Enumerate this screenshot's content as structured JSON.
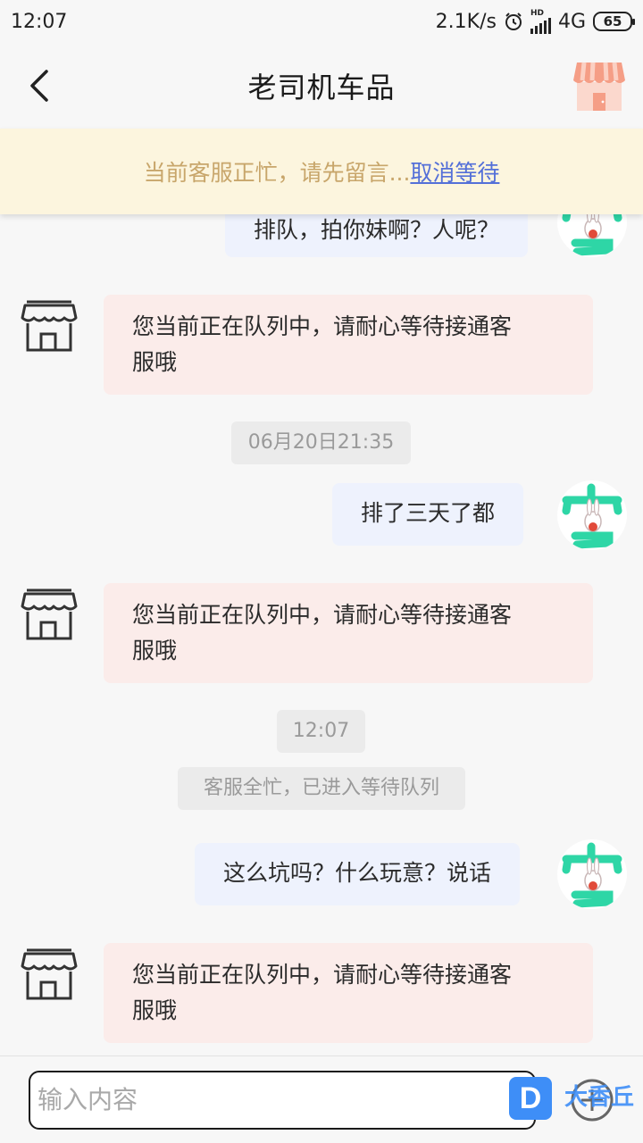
{
  "status_bar": {
    "time": "12:07",
    "speed": "2.1K/s",
    "alarm_icon": "alarm-clock-icon",
    "hd_label": "HD",
    "network": "4G",
    "battery": "65"
  },
  "header": {
    "title": "老司机车品",
    "back_icon": "chevron-left-icon",
    "shop_icon": "storefront-icon"
  },
  "notice": {
    "text": "当前客服正忙，请先留言...",
    "cancel_label": "取消等待"
  },
  "messages": [
    {
      "from": "user",
      "text": "排队，拍你妹啊？人呢？"
    },
    {
      "from": "store",
      "text_line1": "您当前正在队列中，请耐心等待接通客",
      "text_line2": "服哦"
    },
    {
      "type": "time",
      "text": "06月20日21:35"
    },
    {
      "from": "user",
      "text": "排了三天了都"
    },
    {
      "from": "store",
      "text_line1": "您当前正在队列中，请耐心等待接通客",
      "text_line2": "服哦"
    },
    {
      "type": "time",
      "text": "12:07"
    },
    {
      "type": "system",
      "text": "客服全忙，已进入等待队列"
    },
    {
      "from": "user",
      "text": "这么坑吗？什么玩意？说话"
    },
    {
      "from": "store",
      "text_line1": "您当前正在队列中，请耐心等待接通客",
      "text_line2": "服哦"
    }
  ],
  "input": {
    "placeholder": "输入内容",
    "plus_icon": "plus-circle-icon"
  },
  "watermark": {
    "logo_letter": "D",
    "text": "大香丘"
  },
  "colors": {
    "background": "#f7f7f7",
    "notice_bg": "#fcf5de",
    "notice_text": "#c8a66b",
    "link": "#5470d8",
    "user_bubble": "#eef2fd",
    "store_bubble": "#fbecea",
    "avatar_accent": "#2ed6a6",
    "shop_icon": "#f7a48c"
  }
}
